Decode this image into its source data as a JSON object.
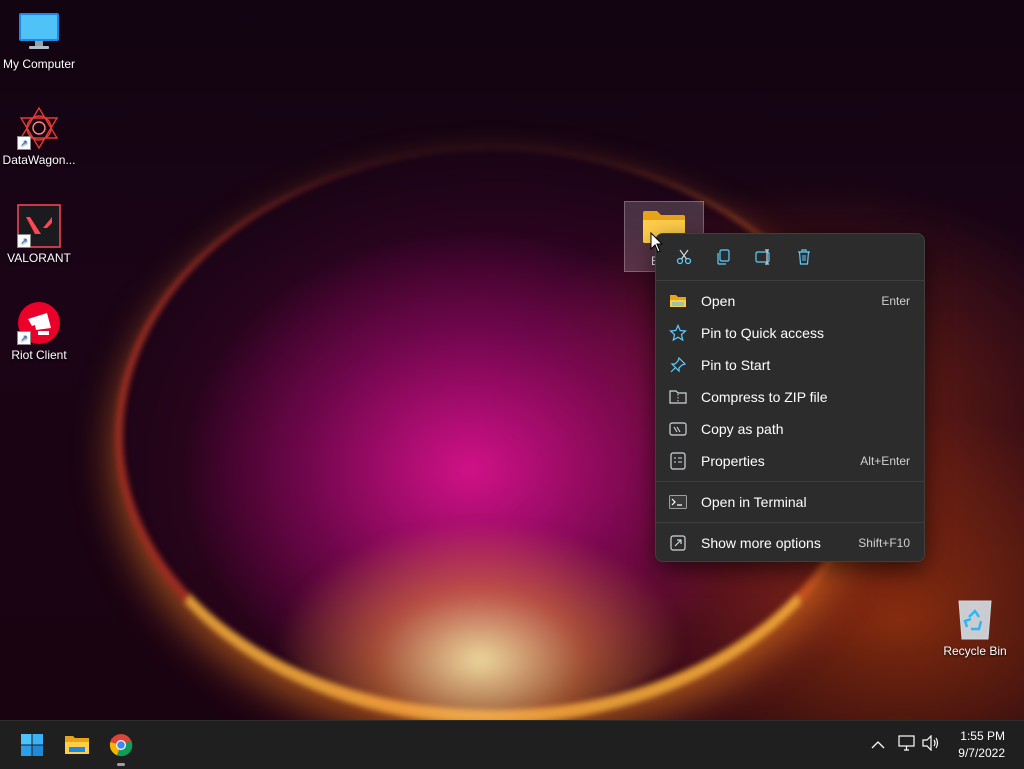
{
  "desktop": {
    "icons": [
      {
        "label": "My Computer",
        "icon": "monitor-icon"
      },
      {
        "label": "DataWagon...",
        "icon": "datawagon-app-icon"
      },
      {
        "label": "VALORANT",
        "icon": "valorant-app-icon"
      },
      {
        "label": "Riot Client",
        "icon": "riot-client-icon"
      },
      {
        "label": "Recycle Bin",
        "icon": "recycle-bin-icon"
      }
    ],
    "selected_folder": {
      "label": "E",
      "icon": "folder-icon"
    }
  },
  "context_menu": {
    "toolbar": [
      {
        "name": "cut",
        "icon": "scissors-icon"
      },
      {
        "name": "copy",
        "icon": "copy-icon"
      },
      {
        "name": "rename",
        "icon": "rename-icon"
      },
      {
        "name": "delete",
        "icon": "trash-icon"
      }
    ],
    "items": [
      {
        "label": "Open",
        "shortcut": "Enter",
        "icon": "folder-open-icon"
      },
      {
        "label": "Pin to Quick access",
        "shortcut": "",
        "icon": "star-icon"
      },
      {
        "label": "Pin to Start",
        "shortcut": "",
        "icon": "pin-icon"
      },
      {
        "label": "Compress to ZIP file",
        "shortcut": "",
        "icon": "zip-icon"
      },
      {
        "label": "Copy as path",
        "shortcut": "",
        "icon": "copy-path-icon"
      },
      {
        "label": "Properties",
        "shortcut": "Alt+Enter",
        "icon": "properties-icon"
      },
      {
        "label": "Open in Terminal",
        "shortcut": "",
        "icon": "terminal-icon"
      },
      {
        "label": "Show more options",
        "shortcut": "Shift+F10",
        "icon": "more-options-icon"
      }
    ]
  },
  "taskbar": {
    "apps": [
      {
        "name": "Start",
        "icon": "windows-start-icon"
      },
      {
        "name": "File Explorer",
        "icon": "file-explorer-icon"
      },
      {
        "name": "Google Chrome",
        "icon": "chrome-icon"
      }
    ],
    "tray": {
      "time": "1:55 PM",
      "date": "9/7/2022"
    }
  },
  "colors": {
    "menu_bg": "#2c2c2c",
    "taskbar_bg": "#1f1f1f",
    "accent_blue": "#60cdff"
  }
}
